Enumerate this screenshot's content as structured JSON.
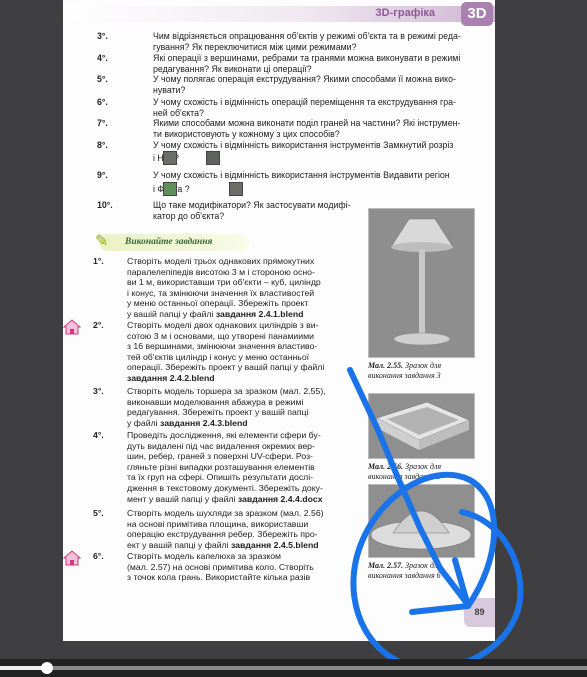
{
  "header": {
    "title": "3D-графіка",
    "badge": "3D"
  },
  "questions": [
    {
      "num": "3°.",
      "lines": [
        "Чим відрізняється опрацювання об'єктів у режимі об'єкта та в режимі реда-",
        "гування? Як переключитися між цими режимами?"
      ]
    },
    {
      "num": "4°.",
      "lines": [
        "Які операції з вершинами, ребрами та гранями можна виконувати в режимі",
        "редагування? Як виконати ці операції?"
      ]
    },
    {
      "num": "5°.",
      "lines": [
        "У чому полягає операція екструдування? Якими способами її можна вико-",
        "нувати?"
      ]
    },
    {
      "num": "6°.",
      "lines": [
        "У чому схожість і відмінність операцій переміщення та екструдування гра-",
        "ней об'єкта?"
      ]
    },
    {
      "num": "7°.",
      "lines": [
        "Якими способами можна виконати поділ граней на частини? Які інструмен-",
        "ти використовують у кожному з цих способів?"
      ]
    },
    {
      "num": "8°.",
      "lines": [
        "У чому схожість і відмінність використання інструментів Замкнутий розріз",
        "і Ніж ?"
      ]
    },
    {
      "num": "9°.",
      "lines": [
        "У чому схожість і відмінність використання інструментів Видавити регіон",
        "і Фаска ?"
      ]
    },
    {
      "num": "10°.",
      "lines": [
        "Що таке модифікатори? Як застосувати модифі-",
        "катор до об'єкта?"
      ]
    }
  ],
  "tasks_heading": "Виконайте завдання",
  "tasks": [
    {
      "num": "1°.",
      "lines": [
        "Створіть моделі трьох однакових прямокутних",
        "паралелепіпедів висотою 3 м і стороною осно-",
        "ви 1 м, використавши три об'єкти – куб, циліндр",
        "і конус, та змінюючи значення їх властивостей",
        "у меню останньої операції. Збережіть проект",
        "у вашій папці у файлі завдання 2.4.1.blend"
      ]
    },
    {
      "num": "2°.",
      "lines": [
        "Створіть моделі двох однакових циліндрів з ви-",
        "сотою 3 м і основами, що утворені панамиими",
        "з 16 вершинами, змінюючи значення властиво-",
        "тей об'єктів циліндр і конус у меню останньої",
        "операції. Збережіть проект у вашій папці у файлі",
        "завдання 2.4.2.blend"
      ]
    },
    {
      "num": "3°.",
      "lines": [
        "Створіть модель торшера за зразком (мал. 2.55),",
        "виконавши моделювання абажура в режимі",
        "редагування. Збережіть проект у вашій папці",
        "у файлі завдання 2.4.3.blend"
      ]
    },
    {
      "num": "4°.",
      "lines": [
        "Проведіть дослідження, які елементи сфери бу-",
        "дуть видалені під час видалення окремих вер-",
        "шин, ребер, граней з поверхні UV-сфери. Роз-",
        "гляньте різні випадки розташування елементів",
        "та їх груп на сфері. Опишіть результати дослі-",
        "дження в текстовому документі. Збережіть доку-",
        "мент у вашій папці у файлі завдання 2.4.4.docx"
      ]
    },
    {
      "num": "5°.",
      "lines": [
        "Створіть модель шухляди за зразком (мал. 2.56)",
        "на основі примітива площина, використавши",
        "операцію екструдування ребер. Збережіть про-",
        "ект у вашій папці у файлі завдання 2.4.5.blend"
      ]
    },
    {
      "num": "6°.",
      "lines": [
        "Створіть модель капелюха за зразком",
        "(мал. 2.57) на основі примітива коло. Створіть",
        "з точок кола грань. Використайте кілька разів"
      ]
    }
  ],
  "figures": [
    {
      "label": "Мал. 2.55.",
      "caption": "Зразок для виконання завдання 3"
    },
    {
      "label": "Мал. 2.56.",
      "caption": "Зразок для виконання завдання 5"
    },
    {
      "label": "Мал. 2.57.",
      "caption": "Зразок для виконання завдання 6"
    }
  ],
  "page_number": "89",
  "player": {
    "progress": 0.08
  },
  "colors": {
    "accent": "#a981b1",
    "annotation": "#1a73e8",
    "background": "#3f3f41"
  }
}
